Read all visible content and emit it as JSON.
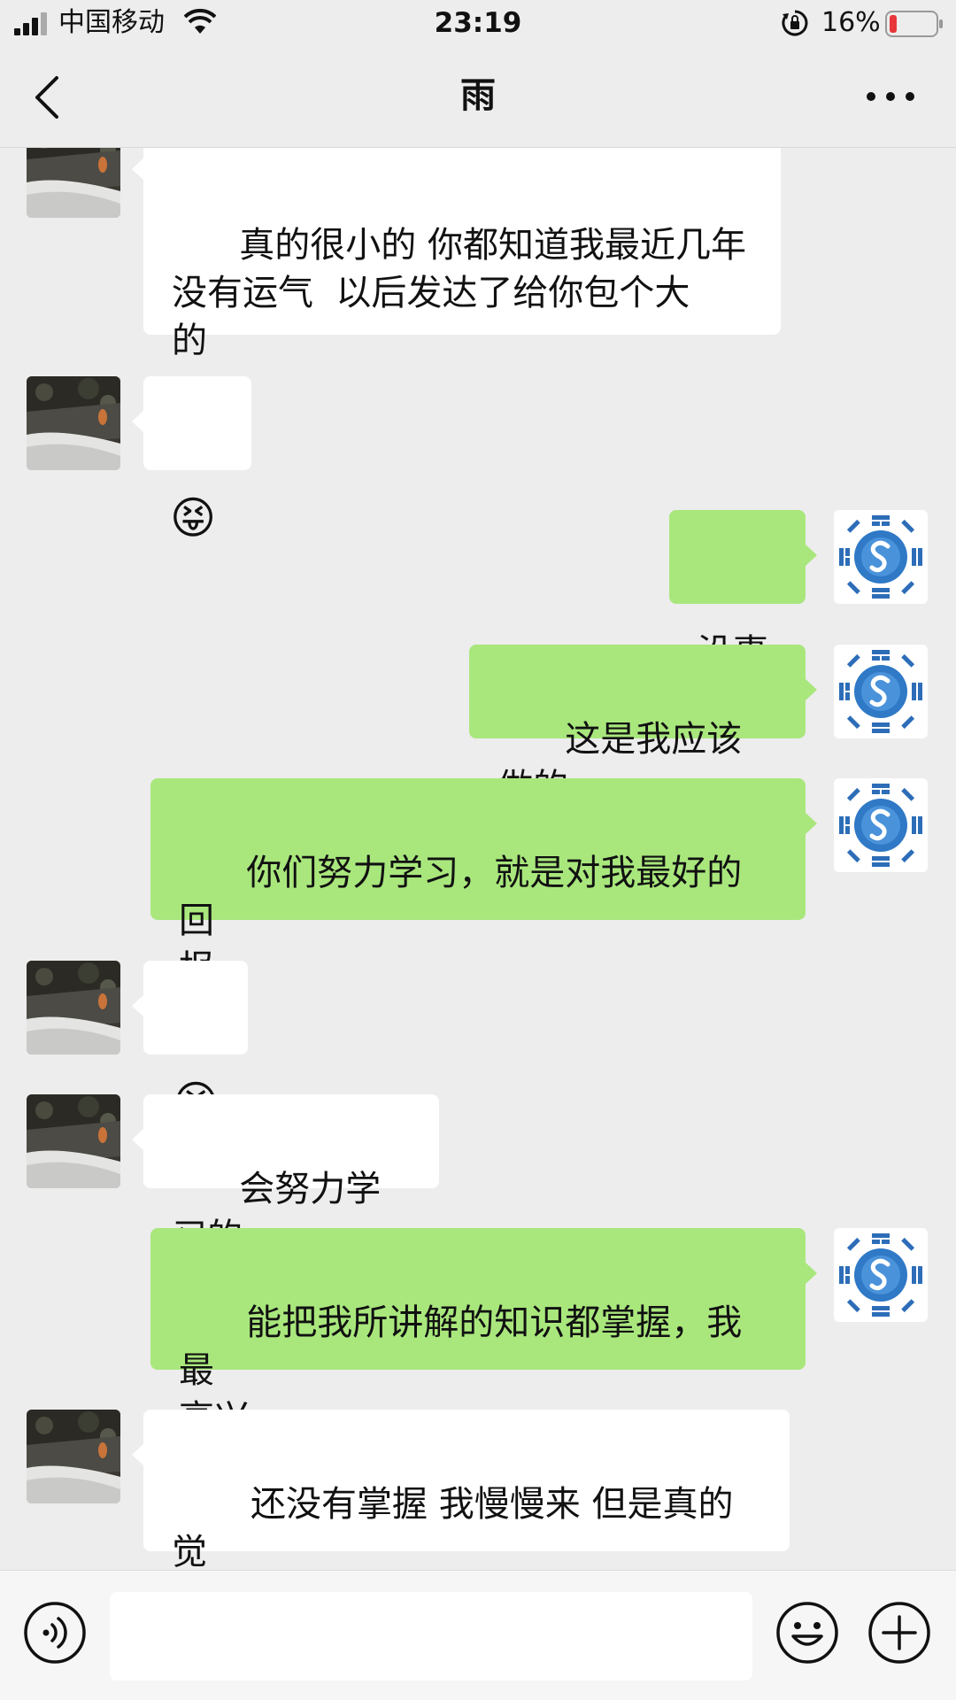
{
  "status_bar": {
    "carrier": "中国移动",
    "time": "23:19",
    "battery_percent": "16%",
    "battery_level": 0.16,
    "battery_color": "#e8363a"
  },
  "nav": {
    "title": "雨",
    "back_icon": "chevron-left-icon",
    "more_icon": "ellipsis-icon"
  },
  "chat": {
    "outgoing_bubble_color": "#a9e77d",
    "incoming_bubble_color": "#ffffff",
    "messages": [
      {
        "from": "contact",
        "text": "真的很小的 你都知道我最近几年\n没有运气  以后发达了给你包个大\n的"
      },
      {
        "from": "contact",
        "emoji": "😝"
      },
      {
        "from": "me",
        "text": "没事"
      },
      {
        "from": "me",
        "text": "这是我应该做的"
      },
      {
        "from": "me",
        "text": "你们努力学习，就是对我最好的回\n报"
      },
      {
        "from": "contact",
        "emoji": "😭"
      },
      {
        "from": "contact",
        "text": "会努力学习的"
      },
      {
        "from": "me",
        "text": "能把我所讲解的知识都掌握，我最\n高兴"
      },
      {
        "from": "contact",
        "text": " 还没有掌握 我慢慢来 但是真的觉\n得老师太好了  很无私"
      }
    ]
  },
  "input_bar": {
    "voice_icon": "voice-icon",
    "emoji_icon": "smiley-icon",
    "plus_icon": "plus-icon",
    "input_value": ""
  }
}
